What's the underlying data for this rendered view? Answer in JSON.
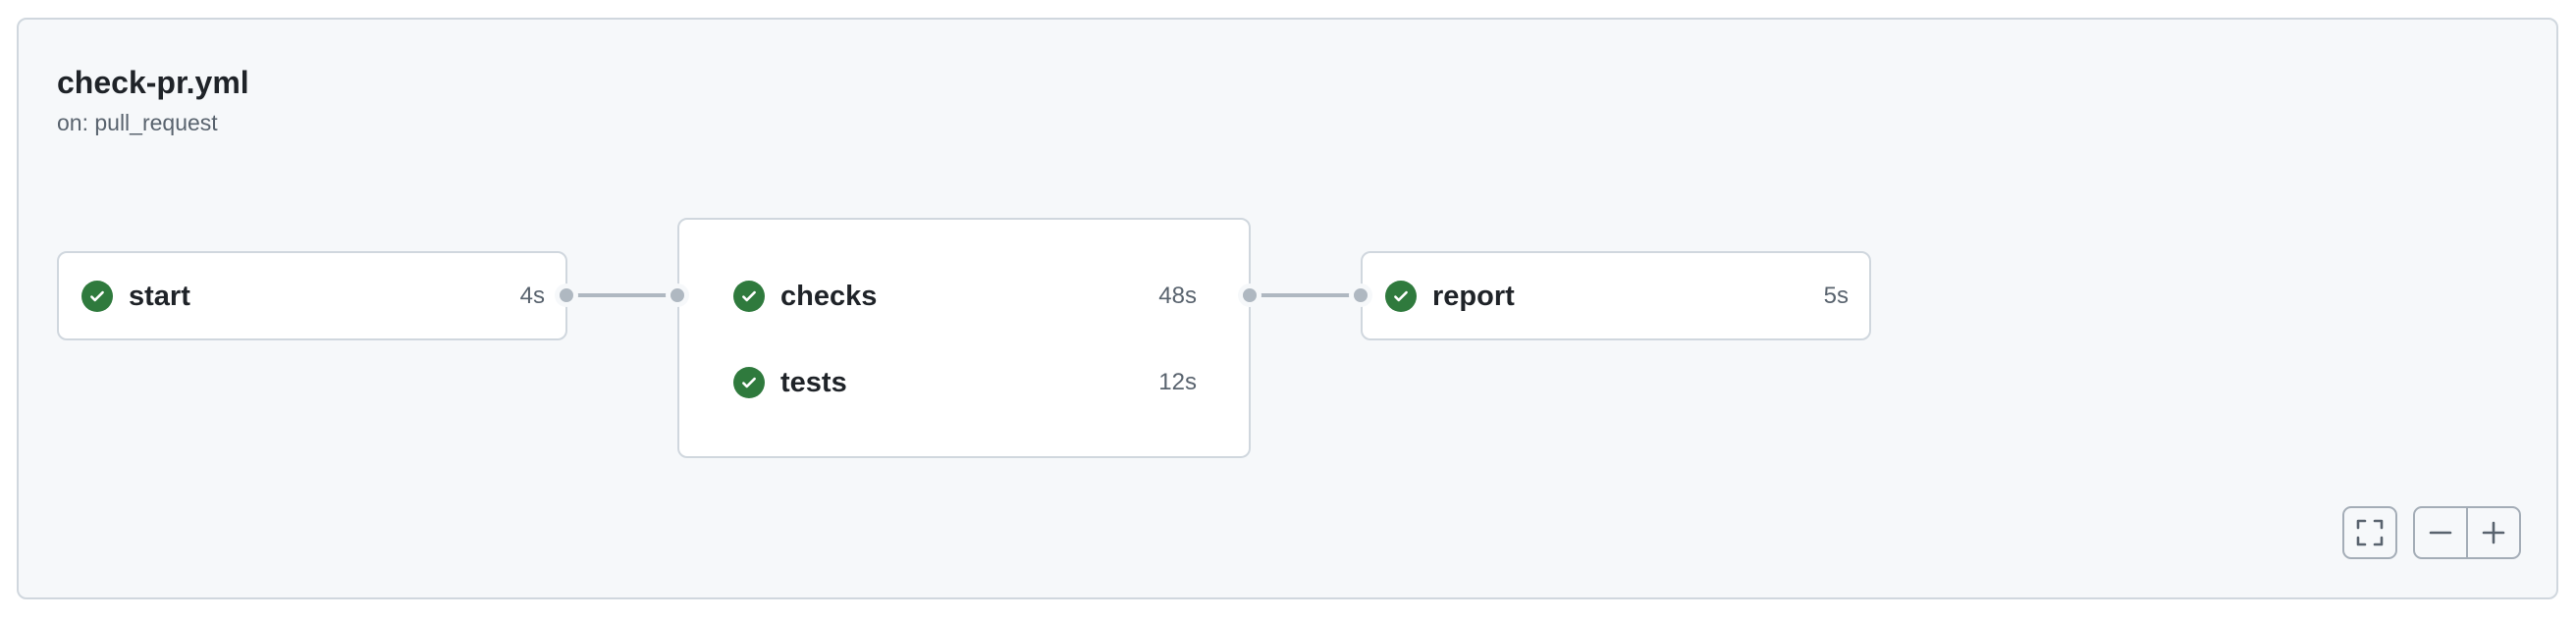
{
  "workflow": {
    "title": "check-pr.yml",
    "trigger": "on: pull_request"
  },
  "jobs": {
    "start": {
      "name": "start",
      "duration": "4s",
      "status": "success"
    },
    "checks": {
      "name": "checks",
      "duration": "48s",
      "status": "success"
    },
    "tests": {
      "name": "tests",
      "duration": "12s",
      "status": "success"
    },
    "report": {
      "name": "report",
      "duration": "5s",
      "status": "success"
    }
  },
  "controls": {
    "fit": "fit-to-screen-icon",
    "zoom_out": "minus-icon",
    "zoom_in": "plus-icon"
  },
  "colors": {
    "success": "#2f7a3d",
    "connector": "#afb8c1",
    "panel_background": "#f6f8fa",
    "border": "#d0d7de"
  }
}
